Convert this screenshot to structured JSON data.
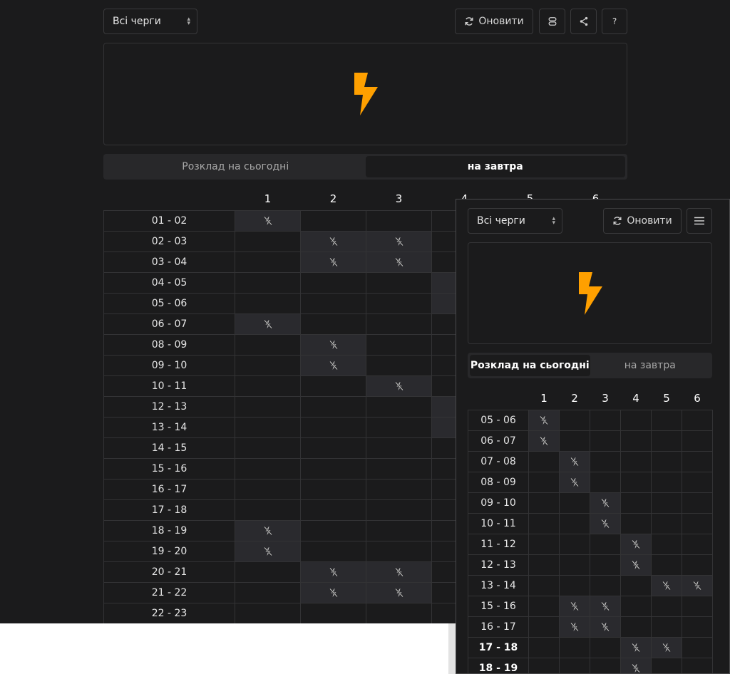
{
  "main": {
    "queue_select": "Всі черги",
    "refresh_label": "Оновити",
    "help_label": "?",
    "tabs": [
      {
        "label": "Розклад на сьогодні",
        "active": false
      },
      {
        "label": "на завтра",
        "active": true
      }
    ],
    "columns": [
      "1",
      "2",
      "3",
      "4",
      "5",
      "6"
    ],
    "rows": [
      {
        "time": "01 - 02",
        "off": [
          1
        ]
      },
      {
        "time": "02 - 03",
        "off": [
          2,
          3
        ]
      },
      {
        "time": "03 - 04",
        "off": [
          2,
          3
        ]
      },
      {
        "time": "04 - 05",
        "off": [
          4
        ]
      },
      {
        "time": "05 - 06",
        "off": [
          4
        ]
      },
      {
        "time": "06 - 07",
        "off": [
          1
        ]
      },
      {
        "time": "08 - 09",
        "off": [
          2
        ]
      },
      {
        "time": "09 - 10",
        "off": [
          2
        ]
      },
      {
        "time": "10 - 11",
        "off": [
          3
        ]
      },
      {
        "time": "12 - 13",
        "off": [
          4
        ]
      },
      {
        "time": "13 - 14",
        "off": [
          4
        ]
      },
      {
        "time": "14 - 15",
        "off": []
      },
      {
        "time": "15 - 16",
        "off": []
      },
      {
        "time": "16 - 17",
        "off": []
      },
      {
        "time": "17 - 18",
        "off": []
      },
      {
        "time": "18 - 19",
        "off": [
          1
        ]
      },
      {
        "time": "19 - 20",
        "off": [
          1
        ]
      },
      {
        "time": "20 - 21",
        "off": [
          2,
          3
        ]
      },
      {
        "time": "21 - 22",
        "off": [
          2,
          3
        ]
      },
      {
        "time": "22 - 23",
        "off": []
      }
    ]
  },
  "mobile": {
    "queue_select": "Всі черги",
    "refresh_label": "Оновити",
    "tabs": [
      {
        "label": "Розклад на сьогодні",
        "active": true
      },
      {
        "label": "на завтра",
        "active": false
      }
    ],
    "columns": [
      "1",
      "2",
      "3",
      "4",
      "5",
      "6"
    ],
    "rows": [
      {
        "time": "05 - 06",
        "off": [
          1
        ],
        "bold": false
      },
      {
        "time": "06 - 07",
        "off": [
          1
        ],
        "bold": false
      },
      {
        "time": "07 - 08",
        "off": [
          2
        ],
        "bold": false
      },
      {
        "time": "08 - 09",
        "off": [
          2
        ],
        "bold": false
      },
      {
        "time": "09 - 10",
        "off": [
          3
        ],
        "bold": false
      },
      {
        "time": "10 - 11",
        "off": [
          3
        ],
        "bold": false
      },
      {
        "time": "11 - 12",
        "off": [
          4
        ],
        "bold": false
      },
      {
        "time": "12 - 13",
        "off": [
          4
        ],
        "bold": false
      },
      {
        "time": "13 - 14",
        "off": [
          5,
          6
        ],
        "bold": false
      },
      {
        "time": "15 - 16",
        "off": [
          2,
          3
        ],
        "bold": false
      },
      {
        "time": "16 - 17",
        "off": [
          2,
          3
        ],
        "bold": false
      },
      {
        "time": "17 - 18",
        "off": [
          4,
          5
        ],
        "bold": true
      },
      {
        "time": "18 - 19",
        "off": [
          4
        ],
        "bold": true
      }
    ]
  },
  "colors": {
    "accent": "#ffa000",
    "background": "#1b1b1c",
    "off_cell": "#2a2a2e"
  },
  "icons": {
    "power_off": "power-off-icon",
    "lightning": "lightning-icon",
    "refresh": "refresh-icon",
    "menu": "menu-icon",
    "share": "share-icon",
    "database": "database-icon"
  }
}
